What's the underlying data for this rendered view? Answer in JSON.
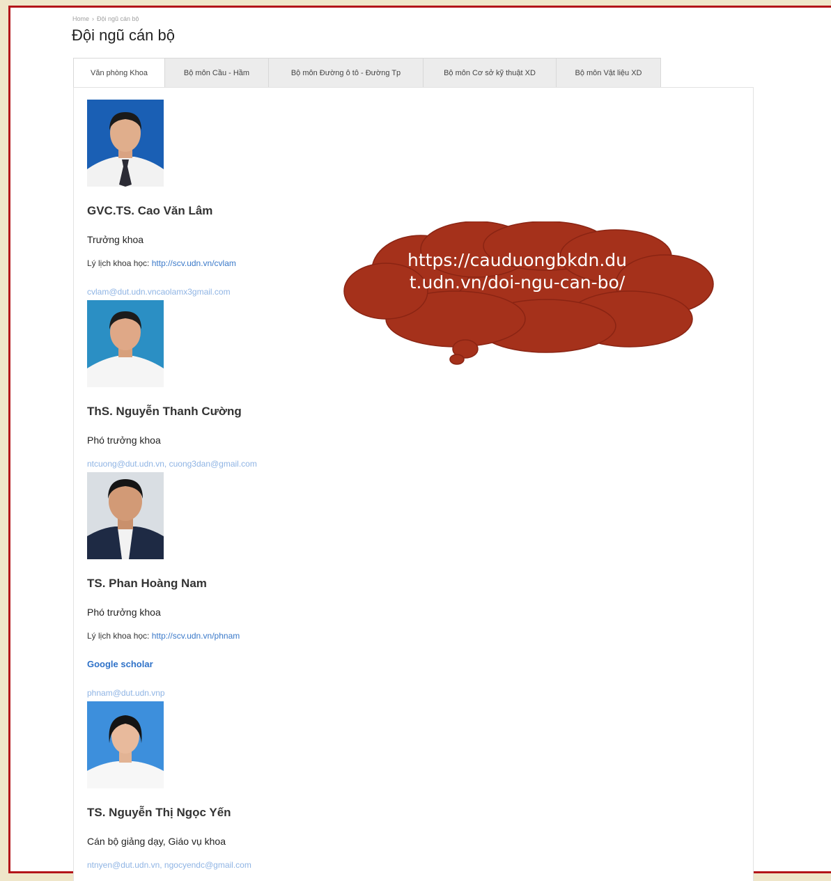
{
  "breadcrumb": {
    "home": "Home",
    "separator": "›",
    "current": "Đội ngũ cán bộ"
  },
  "page_title": "Đội ngũ cán bộ",
  "tabs": [
    {
      "label": "Văn phòng Khoa",
      "active": true
    },
    {
      "label": "Bộ môn Cầu - Hầm",
      "active": false
    },
    {
      "label": "Bộ môn Đường ô tô - Đường Tp",
      "active": false
    },
    {
      "label": "Bộ môn Cơ sở kỹ thuật XD",
      "active": false
    },
    {
      "label": "Bộ môn Vật liệu XD",
      "active": false
    }
  ],
  "staff": [
    {
      "name": "GVC.TS. Cao Văn Lâm",
      "role": "Trưởng khoa",
      "cv_label": "Lý lịch khoa học:",
      "cv_link": "http://scv.udn.vn/cvlam",
      "email": "cvlam@dut.udn.vncaolamx3gmail.com"
    },
    {
      "name": "ThS. Nguyễn Thanh Cường",
      "role": "Phó trưởng khoa",
      "email": "ntcuong@dut.udn.vn, cuong3dan@gmail.com"
    },
    {
      "name": "TS. Phan Hoàng Nam",
      "role": "Phó trưởng khoa",
      "cv_label": "Lý lịch khoa học:",
      "cv_link": "http://scv.udn.vn/phnam",
      "scholar": "Google scholar",
      "email": "phnam@dut.udn.vnp"
    },
    {
      "name": "TS. Nguyễn Thị Ngọc Yến",
      "role": "Cán bộ giảng dạy, Giáo vụ khoa",
      "email": "ntnyen@dut.udn.vn, ngocyendc@gmail.com"
    }
  ],
  "callout": {
    "text": "https://cauduongbkdn.dut.udn.vn/doi-ngu-can-bo/"
  },
  "colors": {
    "frame": "#b3151a",
    "background": "#efe6c9",
    "callout_fill": "#a5311b",
    "link": "#3a79c9"
  }
}
